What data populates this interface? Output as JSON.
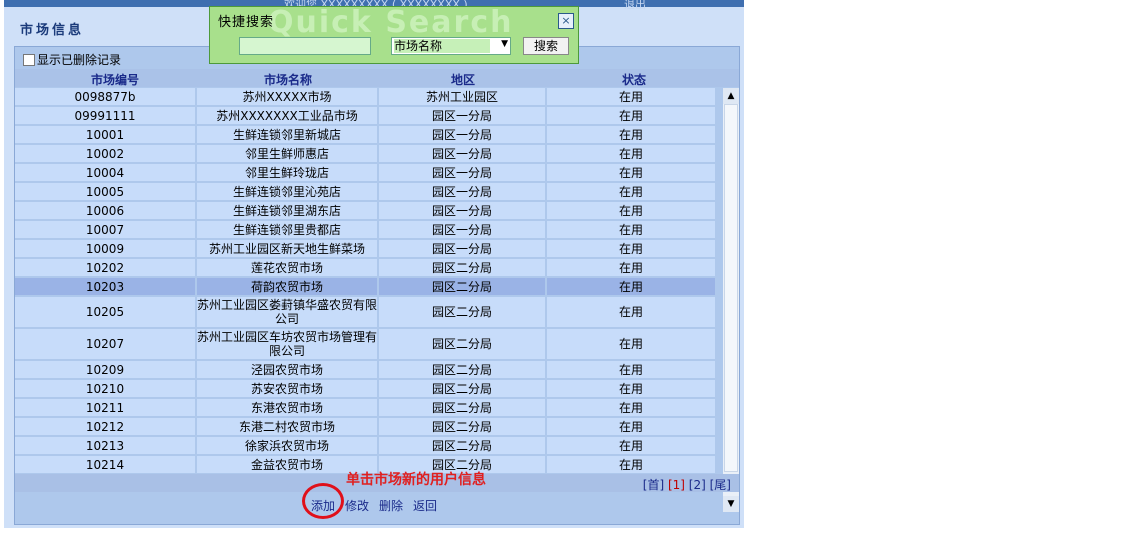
{
  "header": {
    "banner_text": "欢迎您 XXXXXXXXX ( XXXXXXXX )",
    "banner_right": "退出",
    "panel_title": "市场信息"
  },
  "quick_search": {
    "title": "快捷搜索",
    "watermark": "Quick Search",
    "close_label": "×",
    "input_value": "",
    "field_selected": "市场名称",
    "search_button": "搜索"
  },
  "filter": {
    "show_deleted_label": "显示已删除记录"
  },
  "table": {
    "columns": [
      "市场编号",
      "市场名称",
      "地区",
      "状态"
    ],
    "rows": [
      {
        "id": "0098877b",
        "name": "苏州XXXXX市场",
        "area": "苏州工业园区",
        "status": "在用"
      },
      {
        "id": "09991111",
        "name": "苏州XXXXXXX工业品市场",
        "area": "园区一分局",
        "status": "在用"
      },
      {
        "id": "10001",
        "name": "生鲜连锁邻里新城店",
        "area": "园区一分局",
        "status": "在用"
      },
      {
        "id": "10002",
        "name": "邻里生鲜师惠店",
        "area": "园区一分局",
        "status": "在用"
      },
      {
        "id": "10004",
        "name": "邻里生鲜玲珑店",
        "area": "园区一分局",
        "status": "在用"
      },
      {
        "id": "10005",
        "name": "生鲜连锁邻里沁苑店",
        "area": "园区一分局",
        "status": "在用"
      },
      {
        "id": "10006",
        "name": "生鲜连锁邻里湖东店",
        "area": "园区一分局",
        "status": "在用"
      },
      {
        "id": "10007",
        "name": "生鲜连锁邻里贵都店",
        "area": "园区一分局",
        "status": "在用"
      },
      {
        "id": "10009",
        "name": "苏州工业园区新天地生鲜菜场",
        "area": "园区一分局",
        "status": "在用"
      },
      {
        "id": "10202",
        "name": "莲花农贸市场",
        "area": "园区二分局",
        "status": "在用"
      },
      {
        "id": "10203",
        "name": "荷韵农贸市场",
        "area": "园区二分局",
        "status": "在用"
      },
      {
        "id": "10205",
        "name": "苏州工业园区娄葑镇华盛农贸有限公司",
        "area": "园区二分局",
        "status": "在用"
      },
      {
        "id": "10207",
        "name": "苏州工业园区车坊农贸市场管理有限公司",
        "area": "园区二分局",
        "status": "在用"
      },
      {
        "id": "10209",
        "name": "泾园农贸市场",
        "area": "园区二分局",
        "status": "在用"
      },
      {
        "id": "10210",
        "name": "苏安农贸市场",
        "area": "园区二分局",
        "status": "在用"
      },
      {
        "id": "10211",
        "name": "东港农贸市场",
        "area": "园区二分局",
        "status": "在用"
      },
      {
        "id": "10212",
        "name": "东港二村农贸市场",
        "area": "园区二分局",
        "status": "在用"
      },
      {
        "id": "10213",
        "name": "徐家浜农贸市场",
        "area": "园区二分局",
        "status": "在用"
      },
      {
        "id": "10214",
        "name": "金益农贸市场",
        "area": "园区二分局",
        "status": "在用"
      }
    ]
  },
  "pager": {
    "first": "[首]",
    "page1": "[1]",
    "page2": "[2]",
    "last": "[尾]"
  },
  "annotation": {
    "hint": "单击市场新的用户信息"
  },
  "actions": {
    "add": "添加",
    "edit": "修改",
    "delete": "删除",
    "back": "返回"
  }
}
